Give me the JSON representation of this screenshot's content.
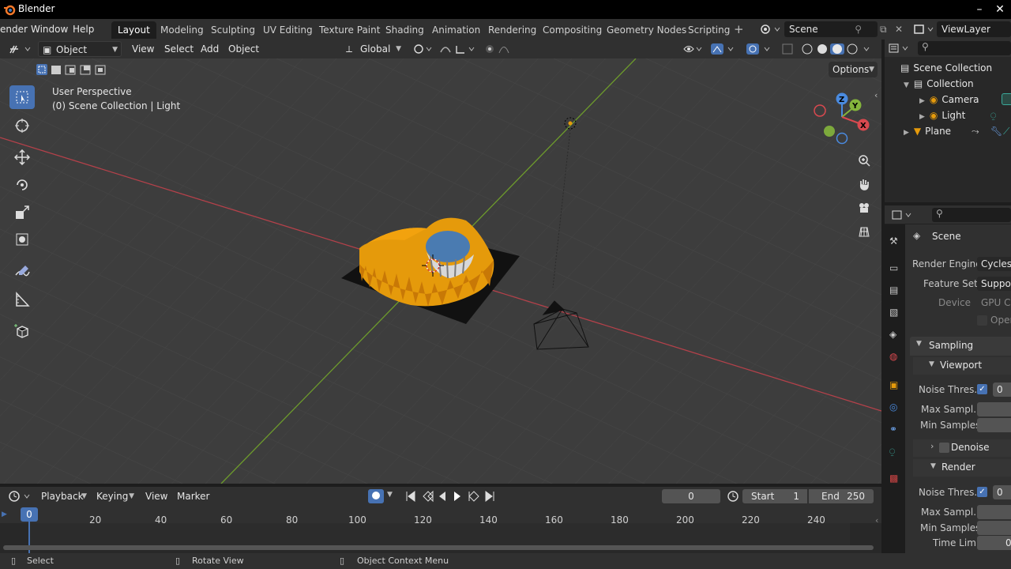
{
  "app": {
    "title": "Blender"
  },
  "menu": {
    "items": [
      "ender",
      "Window",
      "Help"
    ]
  },
  "workspaces": [
    "Layout",
    "Modeling",
    "Sculpting",
    "UV Editing",
    "Texture Paint",
    "Shading",
    "Animation",
    "Rendering",
    "Compositing",
    "Geometry Nodes",
    "Scripting"
  ],
  "active_workspace": "Layout",
  "scene_name": "Scene",
  "view_layer": "ViewLayer",
  "viewport": {
    "mode": "Object Mode",
    "menus": [
      "View",
      "Select",
      "Add",
      "Object"
    ],
    "transform_orientation": "Global",
    "options_label": "Options",
    "perspective_label": "User Perspective",
    "context_label": "(0) Scene Collection | Light",
    "gizmo_axes": [
      "X",
      "Y",
      "Z"
    ]
  },
  "outliner": {
    "rows": [
      {
        "label": "Scene Collection"
      },
      {
        "label": "Collection"
      },
      {
        "label": "Camera"
      },
      {
        "label": "Light"
      },
      {
        "label": "Plane"
      }
    ]
  },
  "properties": {
    "scene_label": "Scene",
    "render_engine_label": "Render Engine",
    "render_engine_value": "Cycles",
    "feature_set_label": "Feature Set",
    "feature_set_value": "Support",
    "device_label": "Device",
    "device_value": "GPU Co",
    "open_label": "Open",
    "sampling_label": "Sampling",
    "viewport_label": "Viewport",
    "noise_threshold_label": "Noise Thres...",
    "noise_threshold_value": "0",
    "max_samples_label": "Max Sampl...",
    "min_samples_label": "Min Samples",
    "denoise_label": "Denoise",
    "render_label": "Render",
    "render_noise_threshold_label": "Noise Thres...",
    "render_noise_threshold_value": "0",
    "render_max_samples_label": "Max Sampl...",
    "render_min_samples_label": "Min Samples",
    "time_limit_label": "Time Limit",
    "time_limit_value": "0"
  },
  "timeline": {
    "menus": [
      "Playback",
      "Keying",
      "View",
      "Marker"
    ],
    "current_frame": "0",
    "start_label": "Start",
    "start_value": "1",
    "end_label": "End",
    "end_value": "250",
    "ticks": [
      "20",
      "40",
      "60",
      "80",
      "100",
      "120",
      "140",
      "160",
      "180",
      "200",
      "220",
      "240"
    ],
    "playhead_label": "0"
  },
  "status": {
    "select": "Select",
    "rotate": "Rotate View",
    "context_menu": "Object Context Menu"
  },
  "colors": {
    "accent": "#4772b3",
    "x_axis": "#d9494f",
    "y_axis": "#84b53c",
    "z_axis": "#4a8be0",
    "object_orange": "#e59a0b"
  }
}
